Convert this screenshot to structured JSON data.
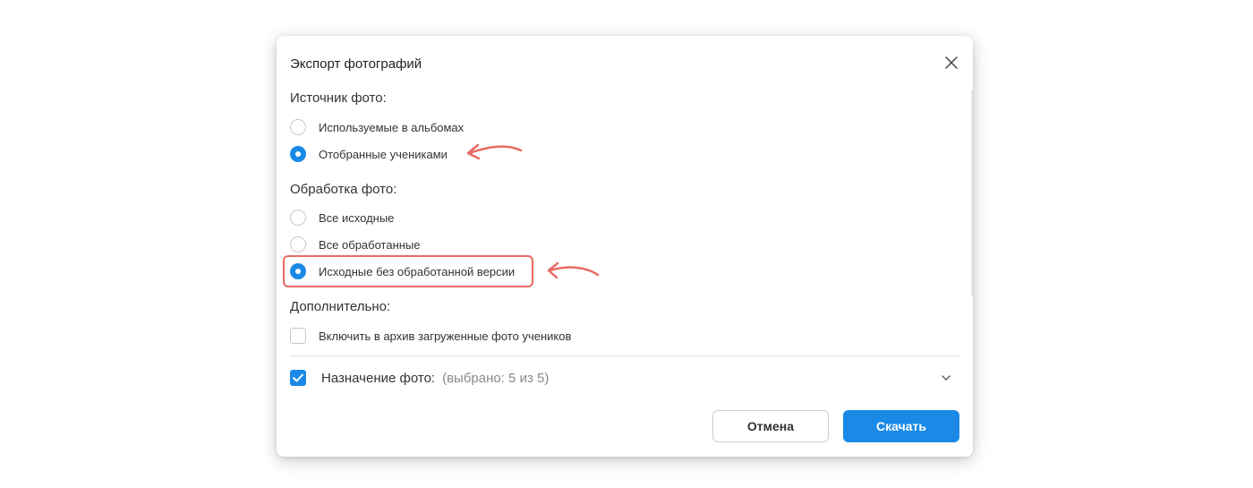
{
  "dialog": {
    "title": "Экспорт фотографий",
    "close_icon": "close-icon"
  },
  "source": {
    "label": "Источник фото:",
    "options": [
      {
        "label": "Используемые в альбомах",
        "checked": false
      },
      {
        "label": "Отобранные учениками",
        "checked": true
      }
    ]
  },
  "processing": {
    "label": "Обработка фото:",
    "options": [
      {
        "label": "Все исходные",
        "checked": false
      },
      {
        "label": "Все обработанные",
        "checked": false
      },
      {
        "label": "Исходные без обработанной версии",
        "checked": true
      }
    ]
  },
  "additional": {
    "label": "Дополнительно:",
    "checkbox": {
      "label": "Включить в архив загруженные фото учеников",
      "checked": false
    }
  },
  "destination": {
    "label": "Назначение фото:",
    "count": "(выбрано: 5 из 5)",
    "checked": true
  },
  "buttons": {
    "cancel": "Отмена",
    "download": "Скачать"
  },
  "colors": {
    "accent": "#1a8ae6",
    "annotation": "#e86a62"
  }
}
